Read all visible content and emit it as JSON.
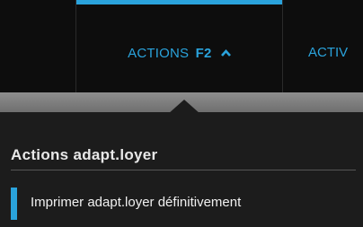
{
  "tabs": {
    "active": {
      "label": "ACTIONS",
      "shortcut": "F2"
    },
    "next": {
      "label": "ACTIV"
    }
  },
  "menu": {
    "section_title": "Actions adapt.loyer",
    "items": [
      {
        "label": "Imprimer adapt.loyer définitivement"
      }
    ]
  },
  "colors": {
    "accent": "#2aa3dc",
    "menu_bg": "#1c1c1c",
    "topbar_bg": "#0d0d0d",
    "strip": "#7a7a7a"
  }
}
